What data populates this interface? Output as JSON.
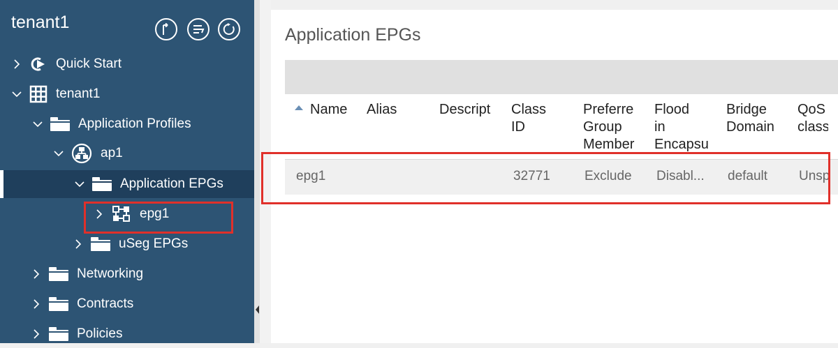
{
  "sidebar": {
    "title": "tenant1",
    "header_buttons": [
      "export-icon",
      "menu-list-icon",
      "refresh-icon"
    ],
    "items": [
      {
        "label": "Quick Start",
        "icon": "quick-start-icon",
        "expanded": false
      },
      {
        "label": "tenant1",
        "icon": "building-icon",
        "expanded": true
      },
      {
        "label": "Application Profiles",
        "icon": "folder-icon",
        "expanded": true
      },
      {
        "label": "ap1",
        "icon": "app-profile-icon",
        "expanded": true
      },
      {
        "label": "Application EPGs",
        "icon": "folder-icon",
        "expanded": true,
        "selected": true
      },
      {
        "label": "epg1",
        "icon": "epg-icon",
        "expanded": false
      },
      {
        "label": "uSeg EPGs",
        "icon": "folder-icon",
        "expanded": false
      },
      {
        "label": "Networking",
        "icon": "folder-icon",
        "expanded": false
      },
      {
        "label": "Contracts",
        "icon": "folder-icon",
        "expanded": false
      },
      {
        "label": "Policies",
        "icon": "folder-icon",
        "expanded": false
      }
    ]
  },
  "main": {
    "title": "Application EPGs",
    "columns": [
      "Name",
      "Alias",
      "Descript",
      "Class\nID",
      "Preferre\nGroup\nMember",
      "Flood\nin\nEncapsu",
      "Bridge\nDomain",
      "QoS\nclass"
    ],
    "rows": [
      {
        "name": "epg1",
        "alias": "",
        "description": "",
        "class_id": "32771",
        "preferred_group": "Exclude",
        "flood": "Disabl...",
        "bridge_domain": "default",
        "qos": "Unsp"
      }
    ]
  },
  "colors": {
    "sidebar_bg": "#2d5474",
    "selected_bg": "#1f3f5c",
    "highlight": "#e0302a"
  }
}
